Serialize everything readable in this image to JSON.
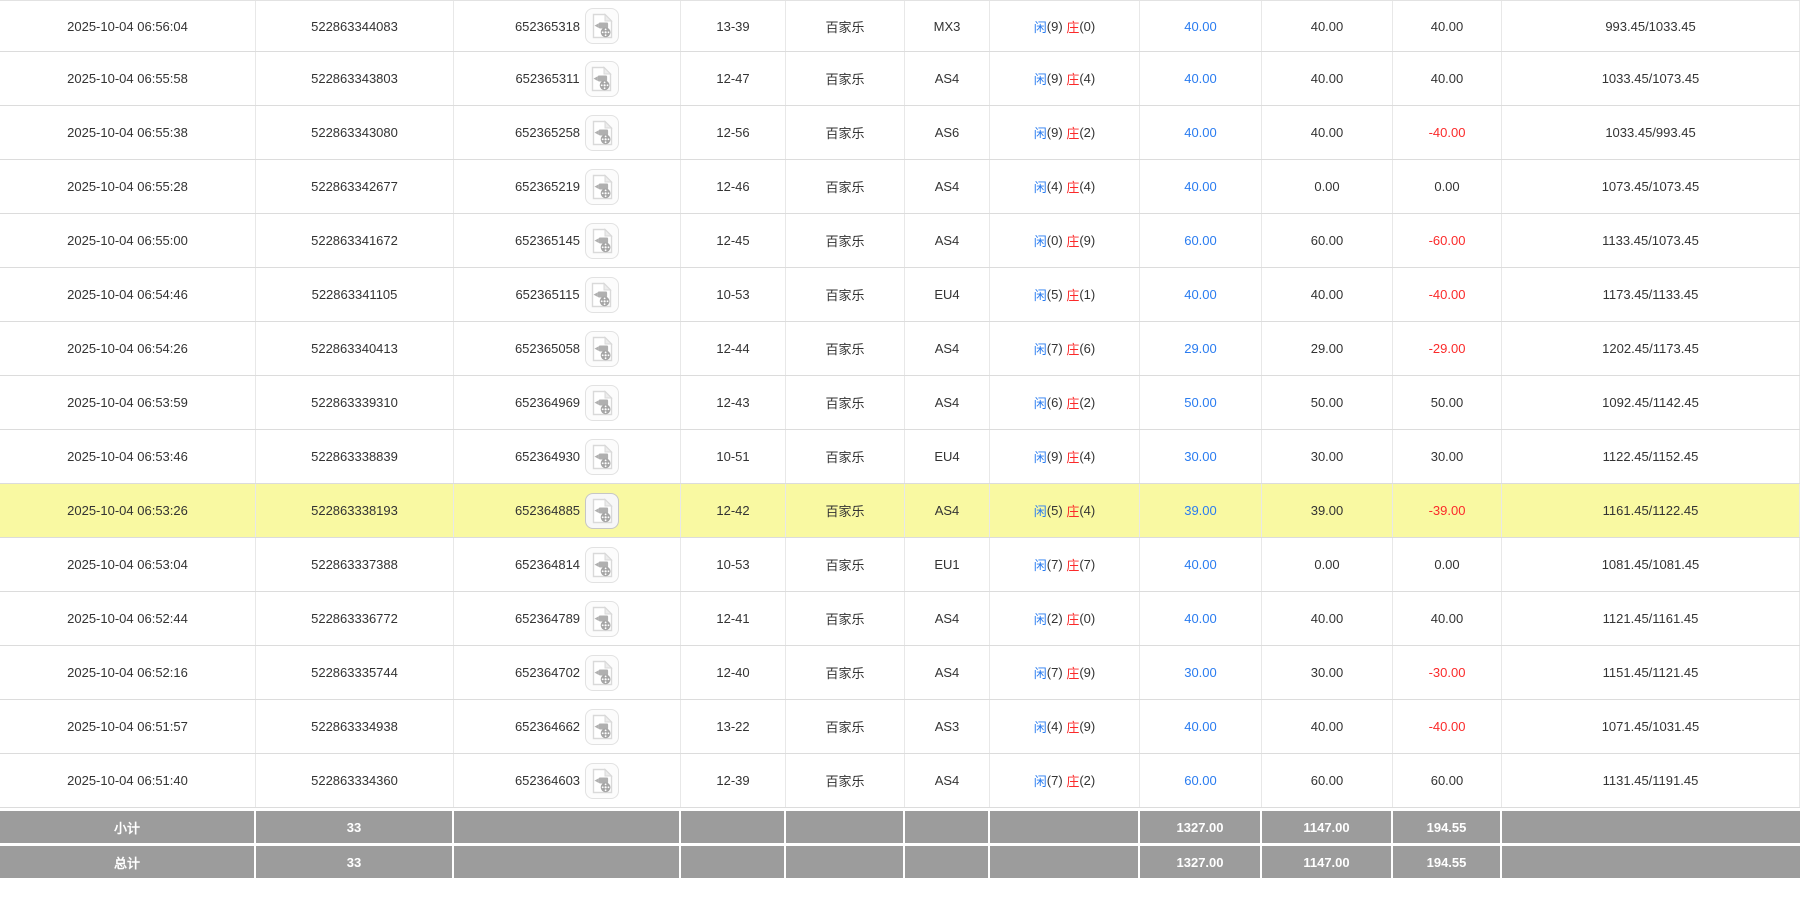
{
  "labels": {
    "player": "闲",
    "banker": "庄",
    "game_type": "百家乐",
    "subtotal": "小计",
    "grand_total": "总计"
  },
  "colors": {
    "player_blue": "#2a7cf0",
    "banker_red": "#fb2a2a",
    "bet_amount_blue": "#2a7cf0",
    "negative_red": "#fb2a2a",
    "highlight_yellow": "#f9f9a2",
    "footer_grey": "#9c9c9c",
    "text": "#333333"
  },
  "icons": {
    "video_replay": "video-replay-icon"
  },
  "table": {
    "rows": [
      {
        "time": "2025-10-04 06:56:04",
        "bet_id": "522863344083",
        "game_id": "652365318",
        "round": "13-39",
        "game_type": "百家乐",
        "table_code": "MX3",
        "player_score": "(9)",
        "banker_score": "(0)",
        "bet_amount": "40.00",
        "valid_amount": "40.00",
        "win_loss": "40.00",
        "balance": "993.45/1033.45",
        "highlight": false
      },
      {
        "time": "2025-10-04 06:55:58",
        "bet_id": "522863343803",
        "game_id": "652365311",
        "round": "12-47",
        "game_type": "百家乐",
        "table_code": "AS4",
        "player_score": "(9)",
        "banker_score": "(4)",
        "bet_amount": "40.00",
        "valid_amount": "40.00",
        "win_loss": "40.00",
        "balance": "1033.45/1073.45",
        "highlight": false
      },
      {
        "time": "2025-10-04 06:55:38",
        "bet_id": "522863343080",
        "game_id": "652365258",
        "round": "12-56",
        "game_type": "百家乐",
        "table_code": "AS6",
        "player_score": "(9)",
        "banker_score": "(2)",
        "bet_amount": "40.00",
        "valid_amount": "40.00",
        "win_loss": "-40.00",
        "balance": "1033.45/993.45",
        "highlight": false
      },
      {
        "time": "2025-10-04 06:55:28",
        "bet_id": "522863342677",
        "game_id": "652365219",
        "round": "12-46",
        "game_type": "百家乐",
        "table_code": "AS4",
        "player_score": "(4)",
        "banker_score": "(4)",
        "bet_amount": "40.00",
        "valid_amount": "0.00",
        "win_loss": "0.00",
        "balance": "1073.45/1073.45",
        "highlight": false
      },
      {
        "time": "2025-10-04 06:55:00",
        "bet_id": "522863341672",
        "game_id": "652365145",
        "round": "12-45",
        "game_type": "百家乐",
        "table_code": "AS4",
        "player_score": "(0)",
        "banker_score": "(9)",
        "bet_amount": "60.00",
        "valid_amount": "60.00",
        "win_loss": "-60.00",
        "balance": "1133.45/1073.45",
        "highlight": false
      },
      {
        "time": "2025-10-04 06:54:46",
        "bet_id": "522863341105",
        "game_id": "652365115",
        "round": "10-53",
        "game_type": "百家乐",
        "table_code": "EU4",
        "player_score": "(5)",
        "banker_score": "(1)",
        "bet_amount": "40.00",
        "valid_amount": "40.00",
        "win_loss": "-40.00",
        "balance": "1173.45/1133.45",
        "highlight": false
      },
      {
        "time": "2025-10-04 06:54:26",
        "bet_id": "522863340413",
        "game_id": "652365058",
        "round": "12-44",
        "game_type": "百家乐",
        "table_code": "AS4",
        "player_score": "(7)",
        "banker_score": "(6)",
        "bet_amount": "29.00",
        "valid_amount": "29.00",
        "win_loss": "-29.00",
        "balance": "1202.45/1173.45",
        "highlight": false
      },
      {
        "time": "2025-10-04 06:53:59",
        "bet_id": "522863339310",
        "game_id": "652364969",
        "round": "12-43",
        "game_type": "百家乐",
        "table_code": "AS4",
        "player_score": "(6)",
        "banker_score": "(2)",
        "bet_amount": "50.00",
        "valid_amount": "50.00",
        "win_loss": "50.00",
        "balance": "1092.45/1142.45",
        "highlight": false
      },
      {
        "time": "2025-10-04 06:53:46",
        "bet_id": "522863338839",
        "game_id": "652364930",
        "round": "10-51",
        "game_type": "百家乐",
        "table_code": "EU4",
        "player_score": "(9)",
        "banker_score": "(4)",
        "bet_amount": "30.00",
        "valid_amount": "30.00",
        "win_loss": "30.00",
        "balance": "1122.45/1152.45",
        "highlight": false
      },
      {
        "time": "2025-10-04 06:53:26",
        "bet_id": "522863338193",
        "game_id": "652364885",
        "round": "12-42",
        "game_type": "百家乐",
        "table_code": "AS4",
        "player_score": "(5)",
        "banker_score": "(4)",
        "bet_amount": "39.00",
        "valid_amount": "39.00",
        "win_loss": "-39.00",
        "balance": "1161.45/1122.45",
        "highlight": true
      },
      {
        "time": "2025-10-04 06:53:04",
        "bet_id": "522863337388",
        "game_id": "652364814",
        "round": "10-53",
        "game_type": "百家乐",
        "table_code": "EU1",
        "player_score": "(7)",
        "banker_score": "(7)",
        "bet_amount": "40.00",
        "valid_amount": "0.00",
        "win_loss": "0.00",
        "balance": "1081.45/1081.45",
        "highlight": false
      },
      {
        "time": "2025-10-04 06:52:44",
        "bet_id": "522863336772",
        "game_id": "652364789",
        "round": "12-41",
        "game_type": "百家乐",
        "table_code": "AS4",
        "player_score": "(2)",
        "banker_score": "(0)",
        "bet_amount": "40.00",
        "valid_amount": "40.00",
        "win_loss": "40.00",
        "balance": "1121.45/1161.45",
        "highlight": false
      },
      {
        "time": "2025-10-04 06:52:16",
        "bet_id": "522863335744",
        "game_id": "652364702",
        "round": "12-40",
        "game_type": "百家乐",
        "table_code": "AS4",
        "player_score": "(7)",
        "banker_score": "(9)",
        "bet_amount": "30.00",
        "valid_amount": "30.00",
        "win_loss": "-30.00",
        "balance": "1151.45/1121.45",
        "highlight": false
      },
      {
        "time": "2025-10-04 06:51:57",
        "bet_id": "522863334938",
        "game_id": "652364662",
        "round": "13-22",
        "game_type": "百家乐",
        "table_code": "AS3",
        "player_score": "(4)",
        "banker_score": "(9)",
        "bet_amount": "40.00",
        "valid_amount": "40.00",
        "win_loss": "-40.00",
        "balance": "1071.45/1031.45",
        "highlight": false
      },
      {
        "time": "2025-10-04 06:51:40",
        "bet_id": "522863334360",
        "game_id": "652364603",
        "round": "12-39",
        "game_type": "百家乐",
        "table_code": "AS4",
        "player_score": "(7)",
        "banker_score": "(2)",
        "bet_amount": "60.00",
        "valid_amount": "60.00",
        "win_loss": "60.00",
        "balance": "1131.45/1191.45",
        "highlight": false
      }
    ],
    "footer_rows": [
      {
        "label": "小计",
        "count": "33",
        "bet_total": "1327.00",
        "valid_total": "1147.00",
        "winloss_total": "194.55"
      },
      {
        "label": "总计",
        "count": "33",
        "bet_total": "1327.00",
        "valid_total": "1147.00",
        "winloss_total": "194.55"
      }
    ]
  }
}
